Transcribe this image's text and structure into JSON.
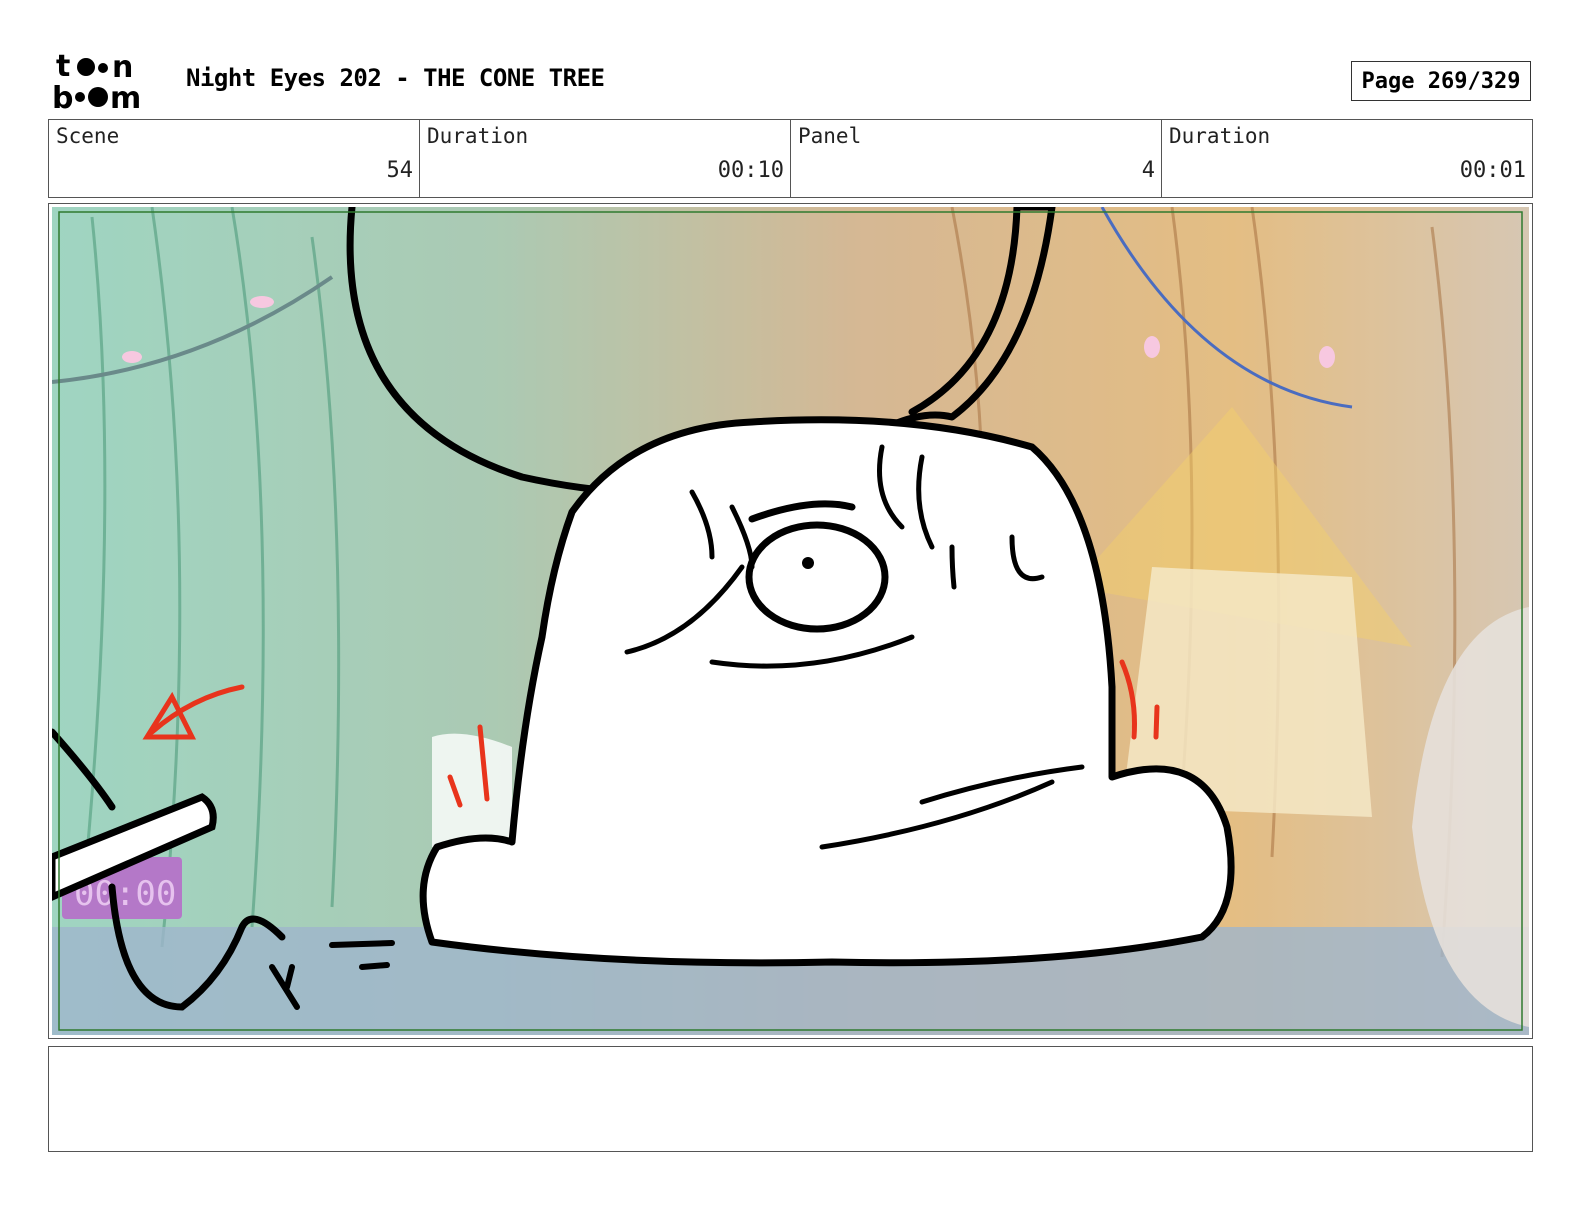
{
  "header": {
    "logo_alt": "toon boom",
    "title": "Night Eyes 202 - THE CONE TREE",
    "page": "Page 269/329"
  },
  "info": {
    "scene_label": "Scene",
    "scene_value": "54",
    "scene_duration_label": "Duration",
    "scene_duration_value": "00:10",
    "panel_label": "Panel",
    "panel_value": "4",
    "panel_duration_label": "Duration",
    "panel_duration_value": "00:01"
  },
  "panel": {
    "clock_display": "00:00"
  },
  "notes": {
    "text": ""
  },
  "colors": {
    "frame_green": "#2f7a2f",
    "red_marks": "#e8341c",
    "bg_teal": "#7fc4a8",
    "bg_orange": "#d9a35a"
  }
}
